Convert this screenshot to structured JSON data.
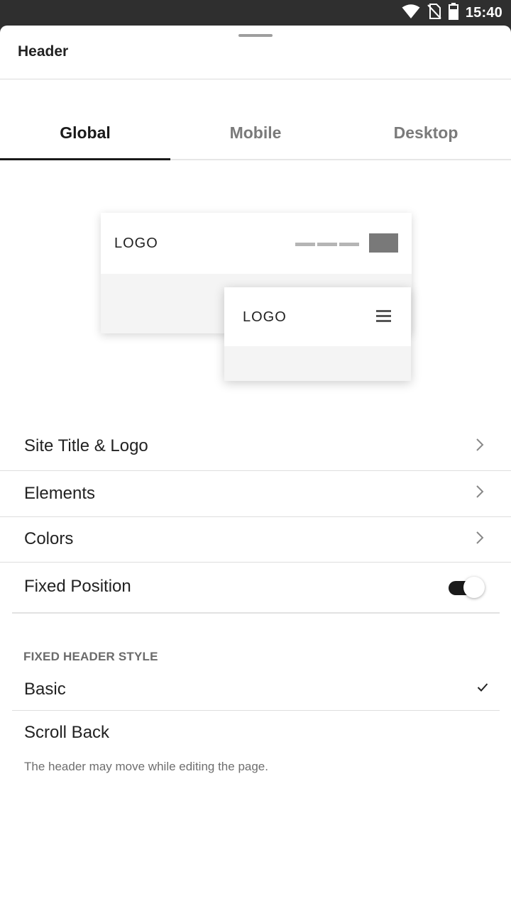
{
  "status_bar": {
    "time": "15:40",
    "icons": [
      "wifi-icon",
      "no-sim-icon",
      "battery-icon"
    ]
  },
  "sheet": {
    "title": "Header"
  },
  "tabs": [
    {
      "label": "Global",
      "active": true
    },
    {
      "label": "Mobile",
      "active": false
    },
    {
      "label": "Desktop",
      "active": false
    }
  ],
  "preview": {
    "desktop_logo": "LOGO",
    "mobile_logo": "LOGO"
  },
  "menu": {
    "site_title_logo": "Site Title & Logo",
    "elements": "Elements",
    "colors": "Colors",
    "fixed_position": "Fixed Position",
    "fixed_position_enabled": true
  },
  "fixed_header_style": {
    "section_label": "FIXED HEADER STYLE",
    "options": [
      {
        "label": "Basic",
        "selected": true
      },
      {
        "label": "Scroll Back",
        "selected": false
      }
    ],
    "helper_text": "The header may move while editing the page."
  },
  "colors": {
    "accent": "#1a1a1a",
    "inactive_tab": "#7a7a7a",
    "status_bar": "#2f2f2f"
  }
}
